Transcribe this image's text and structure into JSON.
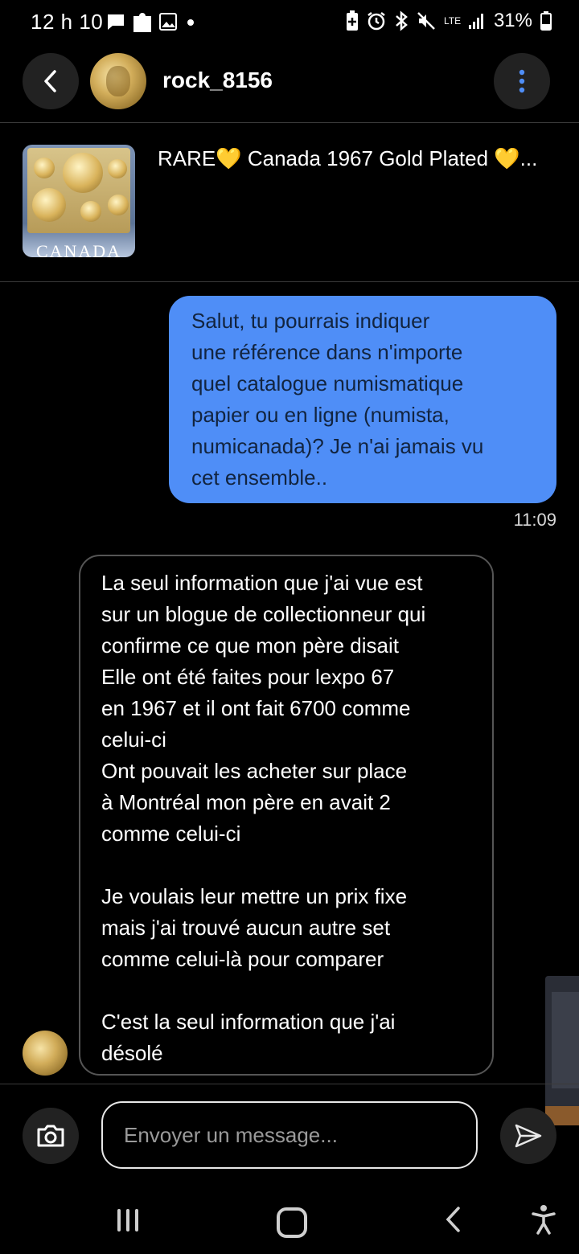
{
  "status_bar": {
    "time": "12 h 10",
    "battery": "31%",
    "network": "LTE"
  },
  "header": {
    "username": "rock_8156"
  },
  "listing": {
    "title": "RARE💛 Canada 1967 Gold Plated 💛...",
    "thumbnail_text": "CANADA"
  },
  "messages": {
    "outgoing": {
      "lines": [
        "Salut, tu pourrais indiquer",
        "une référence dans n'importe",
        "quel catalogue numismatique",
        "papier ou en ligne (numista,",
        "numicanada)? Je n'ai jamais vu",
        "cet ensemble.."
      ],
      "time": "11:09"
    },
    "incoming": {
      "lines": [
        "La seul information que j'ai vue est",
        "sur un blogue de collectionneur qui",
        "confirme ce que mon père disait",
        "Elle ont été faites pour lexpo 67",
        "en 1967 et il ont fait 6700 comme",
        "celui-ci",
        "Ont pouvait les acheter sur place",
        "à Montréal mon père en avait 2",
        "comme celui-ci",
        "",
        "Je voulais leur mettre un prix fixe",
        "mais j'ai trouvé aucun autre set",
        "comme celui-là pour comparer",
        "",
        "C'est la seul information que j'ai",
        "désolé"
      ]
    }
  },
  "composer": {
    "placeholder": "Envoyer un message..."
  },
  "colors": {
    "outgoing_bubble": "#4f8ef7",
    "background": "#000000"
  },
  "icons": [
    "chat-icon",
    "puzzle-icon",
    "image-icon",
    "battery-saver-icon",
    "alarm-icon",
    "bluetooth-icon",
    "mute-icon",
    "signal-icon",
    "battery-icon",
    "back-arrow-icon",
    "more-vertical-icon",
    "camera-icon",
    "send-icon",
    "recent-apps-icon",
    "home-icon",
    "nav-back-icon",
    "accessibility-icon"
  ]
}
